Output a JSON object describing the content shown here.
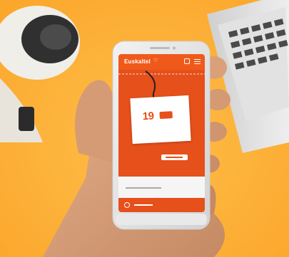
{
  "scene": {
    "desc": "",
    "colors": {
      "background": "#fba72c",
      "background_light": "#ffbe4a",
      "skin": "#d8a07a",
      "skin_shadow": "#b9805b",
      "phone_frame": "#e6e6e6",
      "phone_edge": "#cfcfcf",
      "laptop": "#dcdcdc",
      "keyboard_key": "#4a4a4a",
      "accessory_dark": "#303030",
      "accessory_light": "#f0eee8",
      "app_orange": "#e6501a",
      "app_orange_header": "#ef5a1a"
    }
  },
  "phone_screen": {
    "brand": "Euskaltel",
    "header_icons": [
      "account-icon",
      "menu-icon"
    ],
    "ribbon_text": "",
    "card": {
      "title": "",
      "price_prefix": "19",
      "subtitle": ""
    },
    "bottom_icons": [
      "search-icon"
    ]
  }
}
